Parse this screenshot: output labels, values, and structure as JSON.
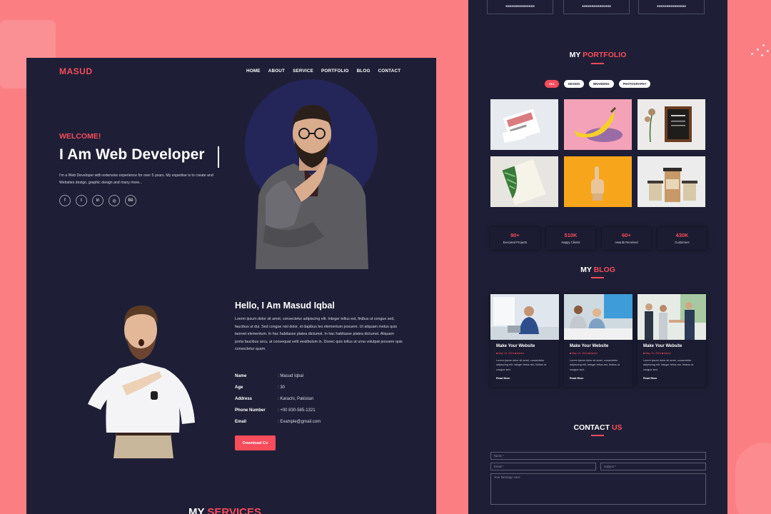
{
  "colors": {
    "accent": "#f64c5b",
    "panel": "#1e1f36",
    "background": "#fb7e83"
  },
  "left": {
    "logo": "MASUD",
    "nav": [
      "HOME",
      "ABOUT",
      "SERVICE",
      "PORTFOLIO",
      "BLOG",
      "CONTACT"
    ],
    "welcome": "WELCOME!",
    "headline": "I Am Web Developer",
    "intro": "I'm a Web Developer with extensive experience for over 5 years. My expertise is to create and Websites design, graphic design and many more...",
    "socials": [
      "facebook-icon",
      "twitter-icon",
      "linkedin-icon",
      "instagram-icon",
      "behance-icon"
    ],
    "about": {
      "title": "Hello, I Am Masud Iqbal",
      "text": "Lorem ipsum dolor sit amet, consectetur adipiscing elit. Integer tellus est, finibus ut congue sed, faucibus ut dui. Sed congue nisl dolor, id dapibus leo elementum posuere. Ut aliquam metus quis laoreet elementum. In hac habitasse platea dictumst. In hac habitasse platea dictumst. Aliquam porta faucibus arcu, at consequat velit vestibulum in. Donec quis tellus ut urna volutpat posuere quis consectetur quam.",
      "info": [
        {
          "label": "Name",
          "value": ": Masud Iqbal"
        },
        {
          "label": "Age",
          "value": ": 30"
        },
        {
          "label": "Address",
          "value": ": Karachi, Pakistan"
        },
        {
          "label": "Phone Number",
          "value": ": +00 830-585-1321"
        },
        {
          "label": "Email",
          "value": ": Example@gmail.com"
        }
      ],
      "download_label": "Download Cv"
    },
    "services_title_a": "MY",
    "services_title_b": "SERVICES"
  },
  "right": {
    "portfolio_title_a": "MY",
    "portfolio_title_b": "PORTFOLIO",
    "filters": [
      "ALL",
      "DESIGN",
      "BRANDING",
      "PHOTOGRAPHY"
    ],
    "tiles": [
      "stationery-mockup",
      "banana",
      "restaurant-menu-board",
      "leaf-notebook",
      "wooden-hand",
      "coffee-cups"
    ],
    "stats": [
      {
        "value": "90+",
        "label": "Executed Projects"
      },
      {
        "value": "510K",
        "label": "Happy Clients"
      },
      {
        "value": "60+",
        "label": "Awards Received"
      },
      {
        "value": "430K",
        "label": "Customers"
      }
    ],
    "blog_title_a": "MY",
    "blog_title_b": "BLOG",
    "blog": [
      {
        "title": "Make Your Website",
        "meta": "■ May 10, 2024 ■ Admin",
        "excerpt": "Lorem ipsum dolor sit amet, consectetur adipiscing elit. Integer tellus est, finibus ut congue sed.",
        "read": "Read More"
      },
      {
        "title": "Make Your Website",
        "meta": "■ May 10, 2024 ■ Admin",
        "excerpt": "Lorem ipsum dolor sit amet, consectetur adipiscing elit. Integer tellus est, finibus ut congue sed.",
        "read": "Read More"
      },
      {
        "title": "Make Your Website",
        "meta": "■ May 10, 2024 ■ Admin",
        "excerpt": "Lorem ipsum dolor sit amet, consectetur adipiscing elit. Integer tellus est, finibus ut congue sed.",
        "read": "Read More"
      }
    ],
    "contact_title_a": "CONTACT",
    "contact_title_b": "US",
    "form": {
      "name": "Name *",
      "email": "Email *",
      "subject": "Subject *",
      "message": "Your Message Here"
    }
  }
}
